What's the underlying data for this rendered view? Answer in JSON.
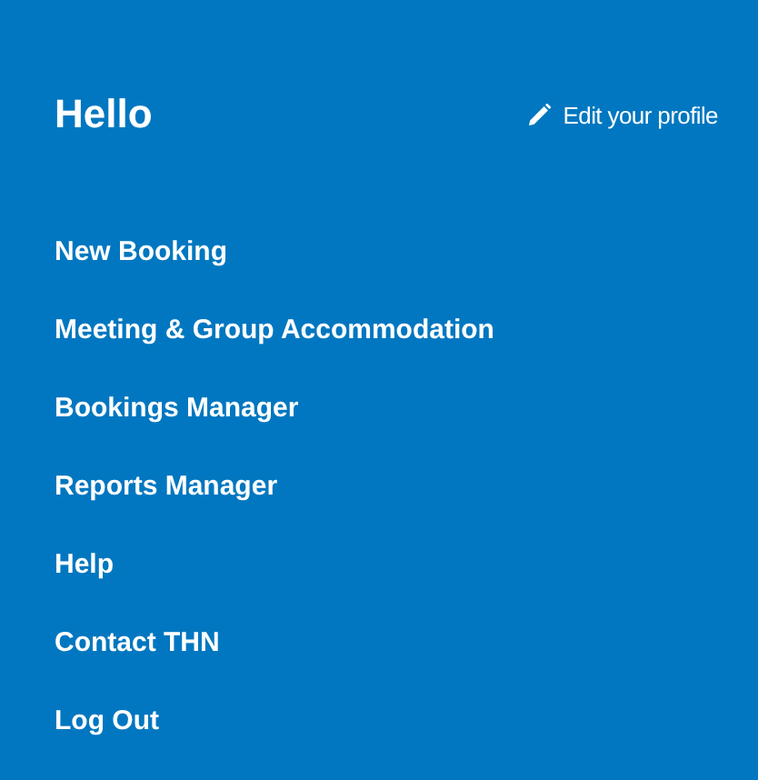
{
  "greeting": "Hello",
  "edit_profile_link": "Edit your profile",
  "menu_items": [
    {
      "label": "New Booking"
    },
    {
      "label": "Meeting & Group Accommodation"
    },
    {
      "label": "Bookings Manager"
    },
    {
      "label": "Reports Manager"
    },
    {
      "label": "Help"
    },
    {
      "label": "Contact THN"
    },
    {
      "label": "Log Out"
    }
  ]
}
